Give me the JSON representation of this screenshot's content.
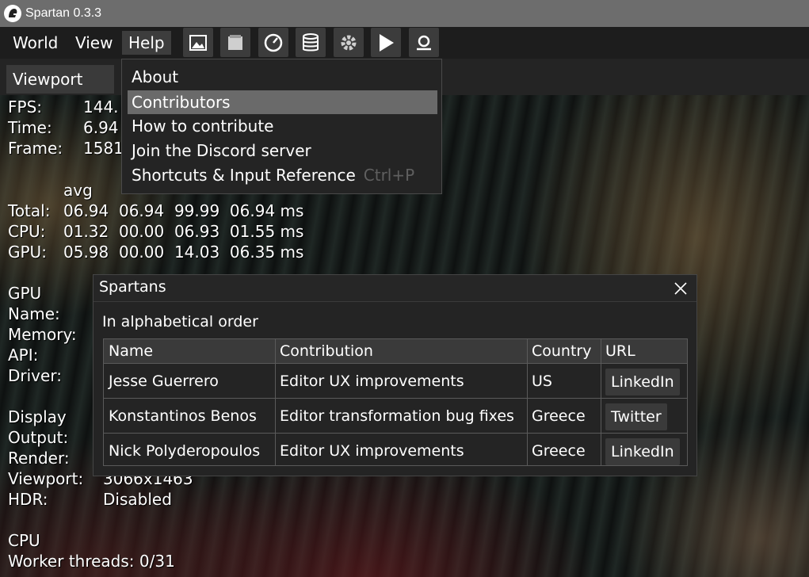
{
  "window": {
    "title": "Spartan 0.3.3"
  },
  "menubar": {
    "items": [
      "World",
      "View",
      "Help"
    ],
    "toolbar_icons": [
      "image-icon",
      "document-icon",
      "gauge-icon",
      "database-icon",
      "gear-icon",
      "play-icon",
      "profiler-icon"
    ]
  },
  "tabs": {
    "viewport": "Viewport"
  },
  "help_menu": {
    "items": [
      "About",
      "Contributors",
      "How to contribute",
      "Join the Discord server",
      "Shortcuts & Input Reference"
    ],
    "hovered": "Contributors",
    "shortcut": "Ctrl+P"
  },
  "stats": {
    "fps_label": "FPS:",
    "fps_value": "144.",
    "time_label": "Time:",
    "time_value": "6.94",
    "frame_label": "Frame:",
    "frame_value": "1581",
    "col_avg": "avg",
    "total_label": "Total:",
    "total_values": "06.94  06.94  99.99  06.94 ms",
    "cpu_label": "CPU:",
    "cpu_values": "01.32  00.00  06.93  01.55 ms",
    "gpu_label": "GPU:",
    "gpu_values": "05.98  00.00  14.03  06.35 ms",
    "gpu_section": "GPU",
    "name_label": "Name:",
    "memory_label": "Memory:",
    "api_label": "API:",
    "driver_label": "Driver:",
    "display_section": "Display",
    "output_label": "Output:",
    "render_label": "Render:",
    "viewport_label": "Viewport:",
    "viewport_value": "3066x1463",
    "hdr_label": "HDR:",
    "hdr_value": "Disabled",
    "cpu_section": "CPU",
    "worker_threads": "Worker threads: 0/31"
  },
  "spartans": {
    "title": "Spartans",
    "subtitle": "In alphabetical order",
    "columns": [
      "Name",
      "Contribution",
      "Country",
      "URL"
    ],
    "rows": [
      {
        "name": "Jesse Guerrero",
        "contribution": "Editor UX improvements",
        "country": "US",
        "url": "LinkedIn"
      },
      {
        "name": "Konstantinos Benos",
        "contribution": "Editor transformation bug fixes",
        "country": "Greece",
        "url": "Twitter"
      },
      {
        "name": "Nick Polyderopoulos",
        "contribution": "Editor UX improvements",
        "country": "Greece",
        "url": "LinkedIn"
      }
    ]
  }
}
